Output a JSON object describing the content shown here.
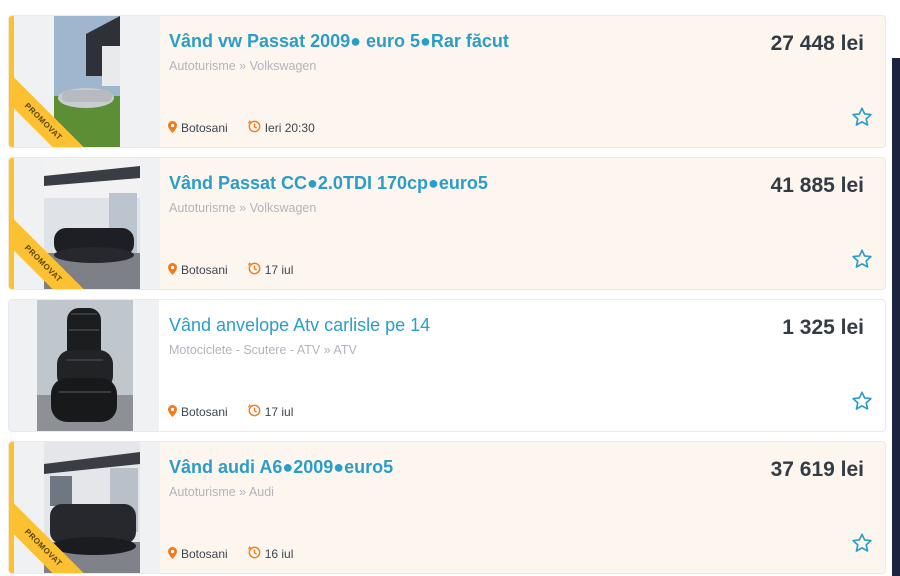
{
  "listings": [
    {
      "title": "Vând vw Passat 2009● euro 5●Rar făcut",
      "category": "Autoturisme » Volkswagen",
      "location": "Botosani",
      "date": "Ieri 20:30",
      "price": "27 448 lei",
      "promoted": true,
      "badge": "PROMOVAT",
      "image": "car-silver-photo"
    },
    {
      "title": "Vând Passat CC●2.0TDI 170cp●euro5",
      "category": "Autoturisme » Volkswagen",
      "location": "Botosani",
      "date": "17 iul",
      "price": "41 885 lei",
      "promoted": true,
      "badge": "PROMOVAT",
      "image": "car-black-photo"
    },
    {
      "title": "Vând anvelope Atv carlisle pe 14",
      "category": "Motociclete - Scutere - ATV » ATV",
      "location": "Botosani",
      "date": "17 iul",
      "price": "1 325 lei",
      "promoted": false,
      "image": "tires-photo"
    },
    {
      "title": "Vând audi A6●2009●euro5",
      "category": "Autoturisme » Audi",
      "location": "Botosani",
      "date": "16 iul",
      "price": "37 619 lei",
      "promoted": true,
      "badge": "PROMOVAT",
      "image": "car-dark-photo"
    }
  ],
  "colors": {
    "title": "#2a9ec9",
    "promoted_background": "#fdf6ee",
    "promoted_accent": "#fcc033",
    "icon_orange": "#f07c1b",
    "star": "#2a9ec9"
  },
  "icons": {
    "location": "location-pin-icon",
    "date": "clock-history-icon",
    "favorite": "star-outline-icon"
  }
}
